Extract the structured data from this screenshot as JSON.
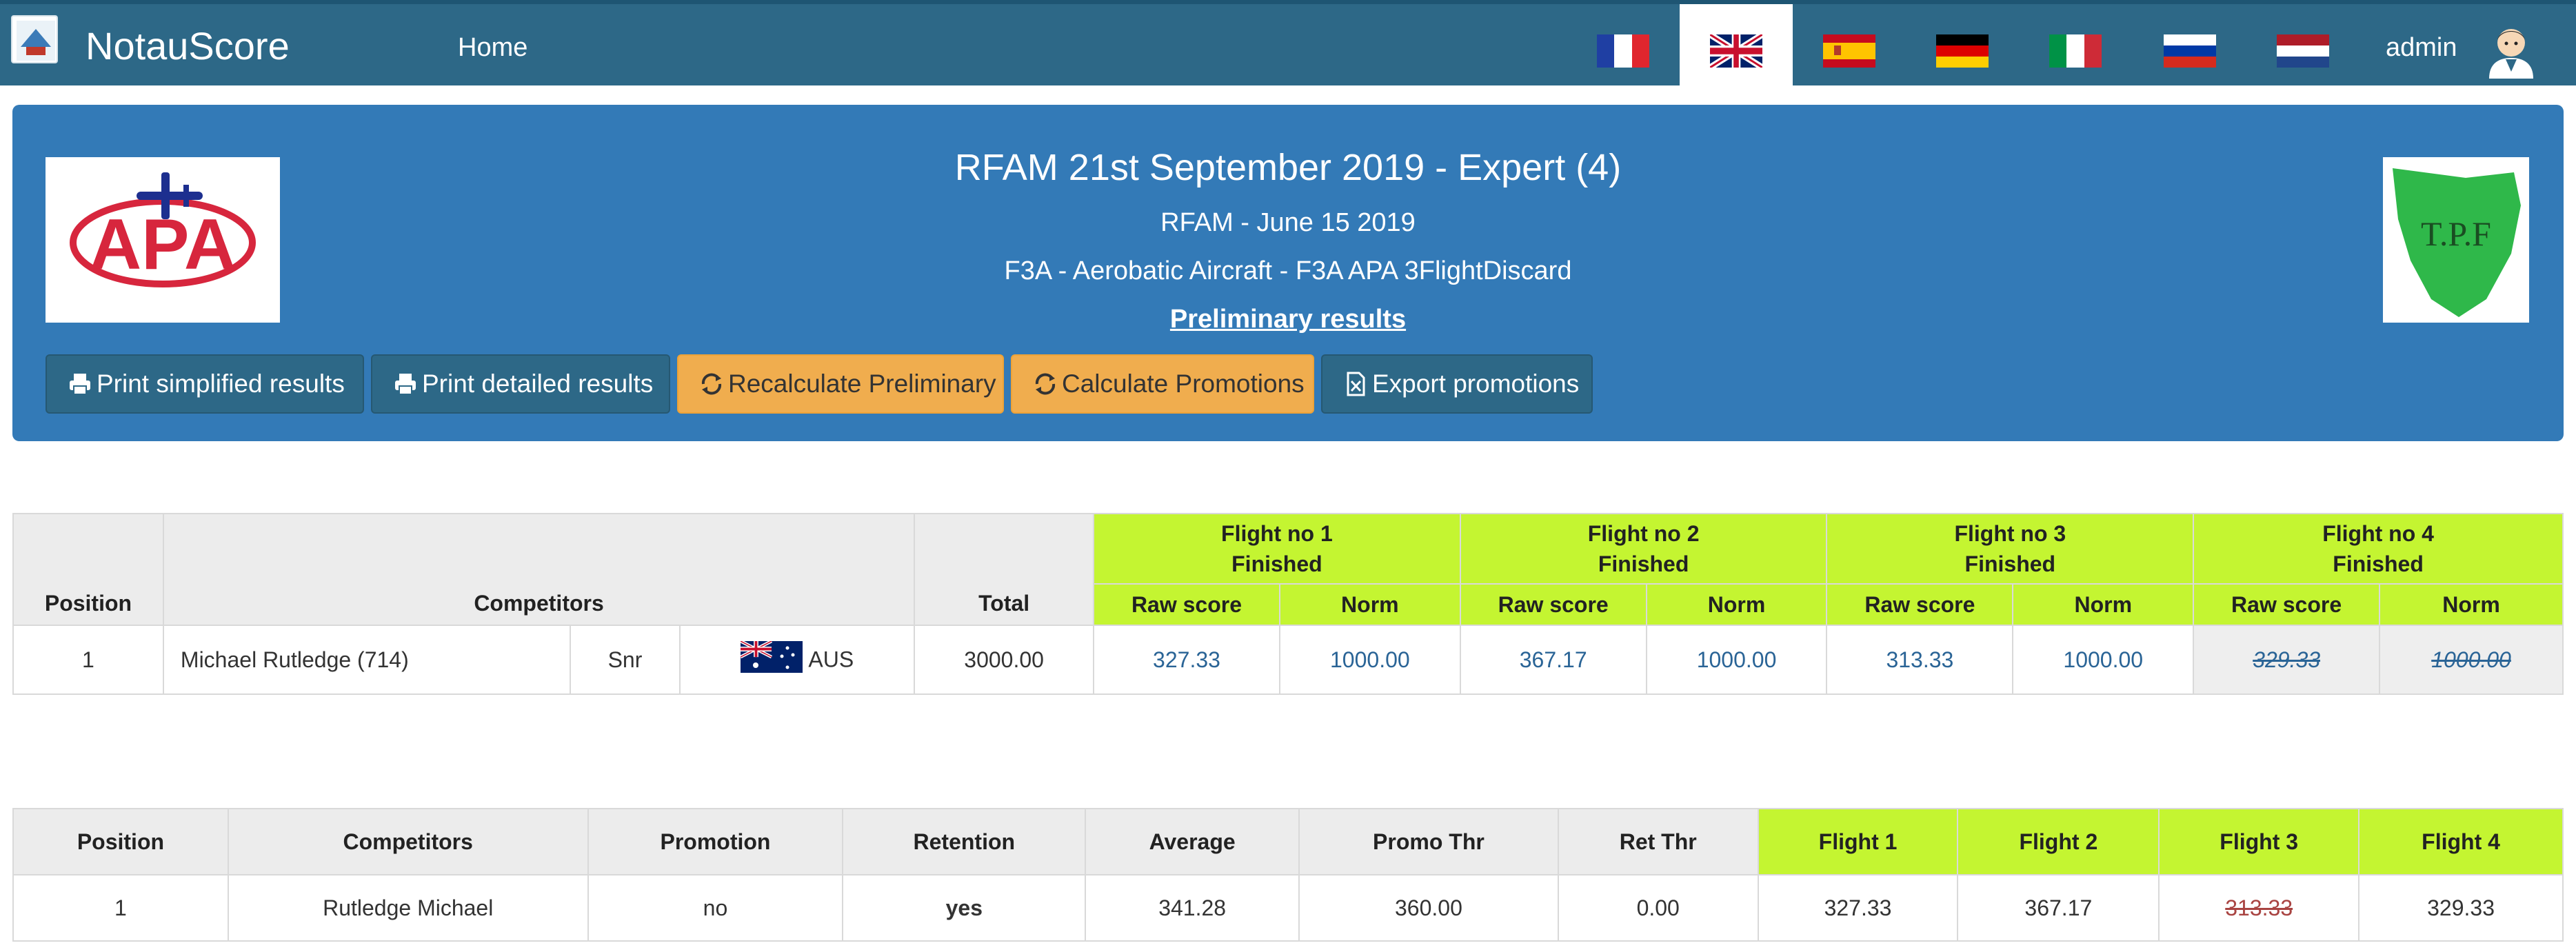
{
  "nav": {
    "brand": "NotauScore",
    "home": "Home",
    "user": "admin",
    "languages": [
      "fr",
      "en",
      "es",
      "de",
      "it",
      "ru",
      "nl"
    ],
    "active_language": "en"
  },
  "header": {
    "title": "RFAM 21st September 2019 - Expert (4)",
    "event": "RFAM - June 15 2019",
    "category": "F3A - Aerobatic Aircraft - F3A APA 3FlightDiscard",
    "status": "Preliminary results",
    "left_logo_text": "APA",
    "right_logo_text": "T.P.F",
    "buttons": {
      "print_simplified": "Print simplified results",
      "print_detailed": "Print detailed results",
      "recalc_preliminary": "Recalculate Preliminary",
      "calc_promotions": "Calculate Promotions",
      "export_promotions": "Export promotions"
    }
  },
  "results": {
    "headers": {
      "position": "Position",
      "competitors": "Competitors",
      "total": "Total",
      "raw": "Raw score",
      "norm": "Norm"
    },
    "flights": [
      {
        "name": "Flight no 1",
        "status": "Finished"
      },
      {
        "name": "Flight no 2",
        "status": "Finished"
      },
      {
        "name": "Flight no 3",
        "status": "Finished"
      },
      {
        "name": "Flight no 4",
        "status": "Finished"
      }
    ],
    "rows": [
      {
        "position": "1",
        "name": "Michael Rutledge (714)",
        "class": "Snr",
        "country": "AUS",
        "total": "3000.00",
        "scores": [
          {
            "raw": "327.33",
            "norm": "1000.00"
          },
          {
            "raw": "367.17",
            "norm": "1000.00"
          },
          {
            "raw": "313.33",
            "norm": "1000.00"
          },
          {
            "raw": "329.33",
            "norm": "1000.00",
            "discarded": true
          }
        ]
      }
    ]
  },
  "promotions": {
    "headers": [
      "Position",
      "Competitors",
      "Promotion",
      "Retention",
      "Average",
      "Promo Thr",
      "Ret Thr",
      "Flight 1",
      "Flight 2",
      "Flight 3",
      "Flight 4"
    ],
    "rows": [
      {
        "position": "1",
        "name": "Rutledge Michael",
        "promotion": "no",
        "retention": "yes",
        "average": "341.28",
        "promo_thr": "360.00",
        "ret_thr": "0.00",
        "flights": [
          "327.33",
          "367.17",
          "313.33",
          "329.33"
        ]
      }
    ]
  },
  "colors": {
    "navbar": "#2d6887",
    "panel": "#337ab7",
    "flight_header": "#c4f531",
    "warning_button": "#f0ad4e"
  }
}
